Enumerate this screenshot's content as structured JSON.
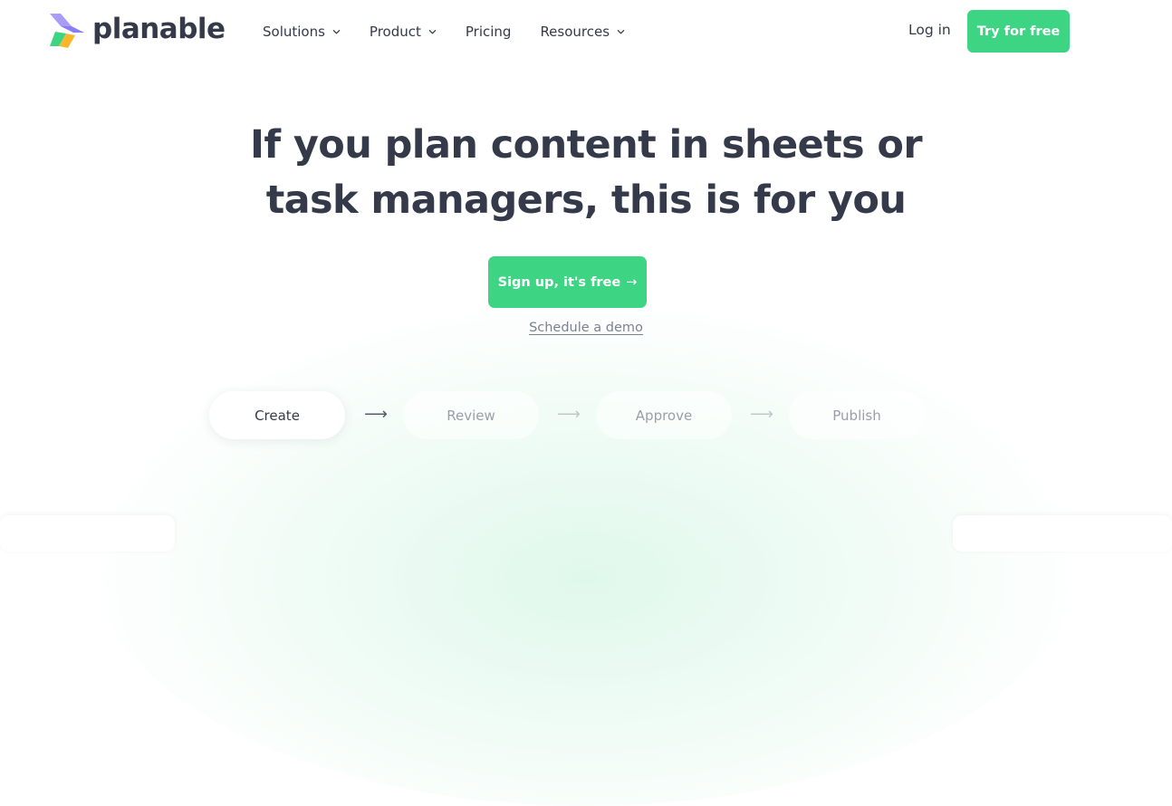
{
  "brand": {
    "name": "planable",
    "colors": {
      "accent": "#3dd484",
      "text": "#353a4b",
      "muted": "#9a9ea8",
      "logo_purple": "#8b7cf6",
      "logo_green": "#3dd484",
      "logo_yellow": "#f7b82e"
    }
  },
  "nav": {
    "items": [
      {
        "label": "Solutions",
        "icon": "chevron-down-icon"
      },
      {
        "label": "Product",
        "icon": "chevron-down-icon"
      },
      {
        "label": "Pricing"
      },
      {
        "label": "Resources",
        "icon": "chevron-down-icon"
      }
    ],
    "login_label": "Log in",
    "cta_label": "Try for free"
  },
  "hero": {
    "headline_line1": "If you plan content in sheets or",
    "headline_line2": "task managers, this is for you",
    "signup_label": "Sign up, it's free",
    "signup_arrow": "→",
    "demo_label": "Schedule a demo"
  },
  "workflow": {
    "steps": [
      {
        "label": "Create",
        "active": true
      },
      {
        "label": "Review",
        "active": false
      },
      {
        "label": "Approve",
        "active": false
      },
      {
        "label": "Publish",
        "active": false
      }
    ],
    "arrow": "⟶"
  }
}
